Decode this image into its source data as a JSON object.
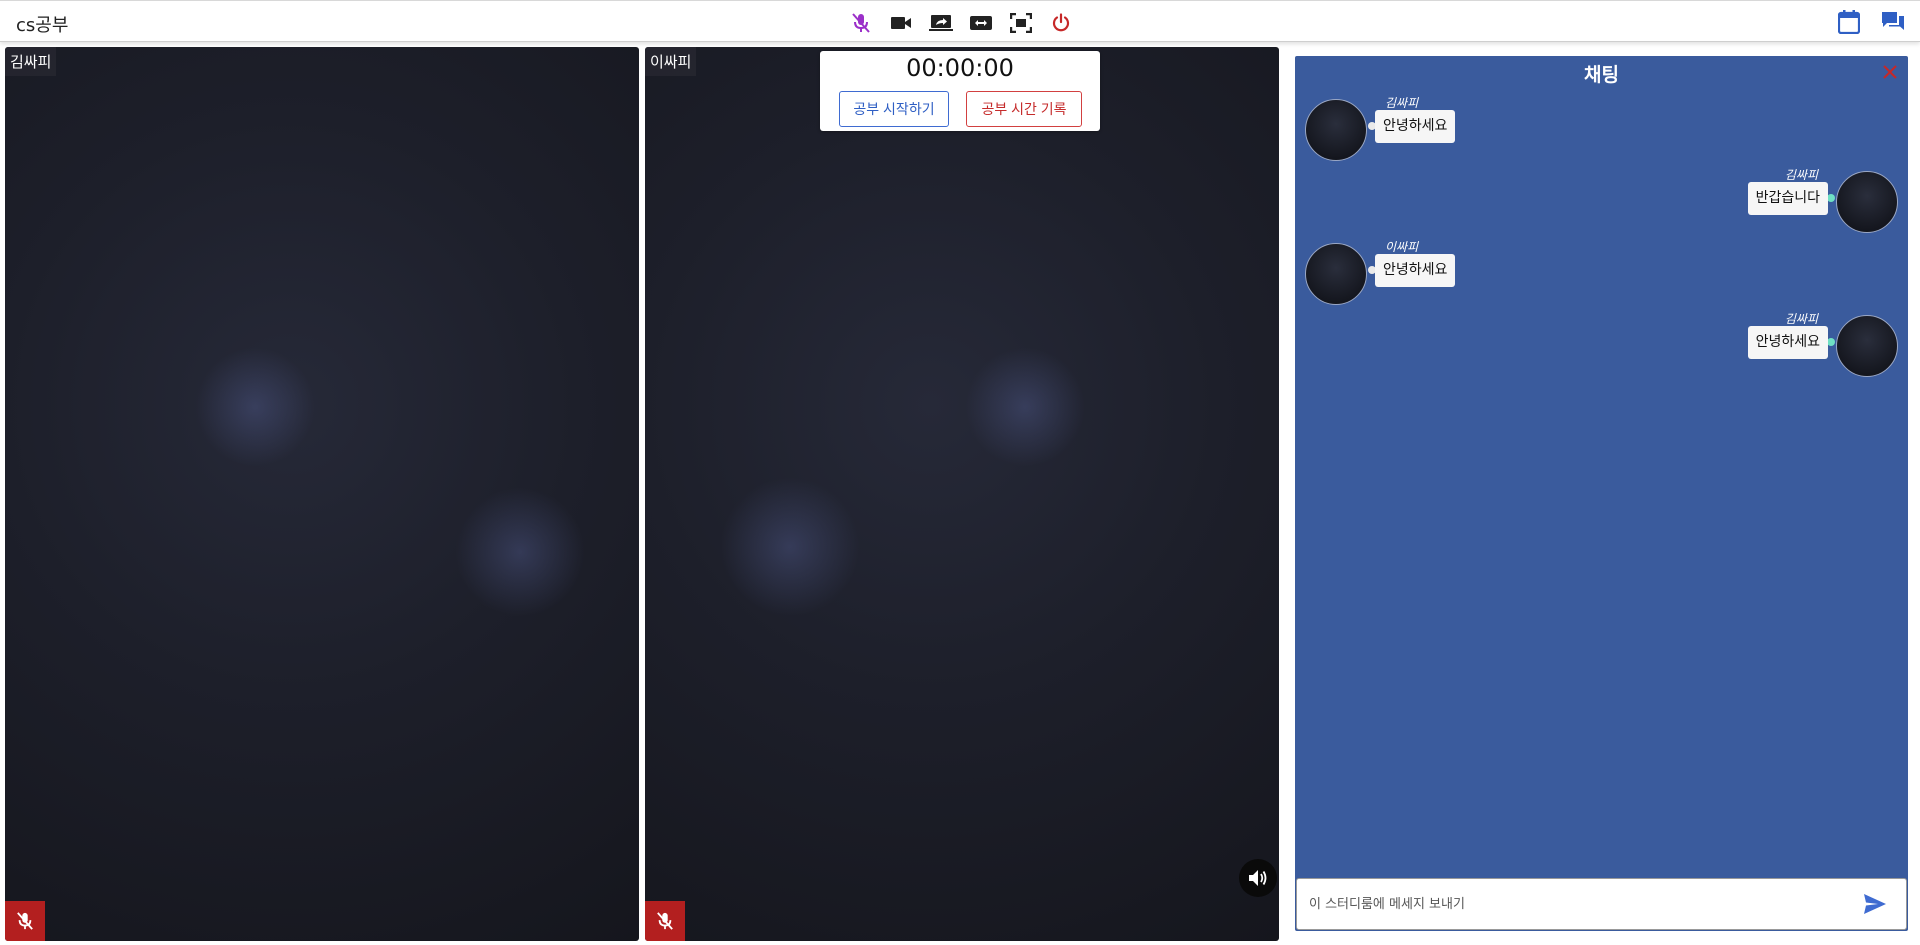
{
  "header": {
    "room_title": "cs공부",
    "toolbar_icons": [
      "mic-off-icon",
      "video-camera-icon",
      "screen-share-icon",
      "switch-camera-icon",
      "fullscreen-icon",
      "power-icon"
    ],
    "right_icons": [
      "calendar-icon",
      "chat-icon"
    ]
  },
  "videos": [
    {
      "name": "김싸피",
      "muted": true,
      "volume_button": false
    },
    {
      "name": "이싸피",
      "muted": true,
      "volume_button": true
    }
  ],
  "timer": {
    "time": "00:00:00",
    "start_label": "공부 시작하기",
    "record_label": "공부 시간 기록"
  },
  "chat": {
    "title": "채팅",
    "messages": [
      {
        "sender": "김싸피",
        "text": "안녕하세요",
        "side": "left"
      },
      {
        "sender": "김싸피",
        "text": "반갑습니다",
        "side": "right"
      },
      {
        "sender": "이싸피",
        "text": "안녕하세요",
        "side": "left"
      },
      {
        "sender": "김싸피",
        "text": "안녕하세요",
        "side": "right"
      }
    ],
    "input_placeholder": "이 스터디룸에 메세지 보내기"
  },
  "colors": {
    "chat_background": "#3a5b9d",
    "mic_off_toolbar": "#9b30c9",
    "power": "#c62828",
    "mute_badge": "#b31f1f",
    "accent_blue": "#3f6bd1"
  }
}
